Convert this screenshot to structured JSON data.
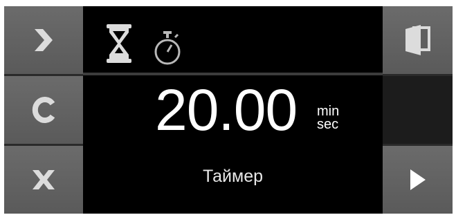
{
  "display": {
    "time_value": "20.00",
    "unit_top": "min",
    "unit_bottom": "sec",
    "mode_label": "Таймер"
  },
  "icons": {
    "left": [
      "chevron-right-icon",
      "clear-c-icon",
      "cancel-x-icon"
    ],
    "mode": [
      "hourglass-icon",
      "stopwatch-icon"
    ],
    "right": [
      "door-icon",
      "play-arrow-icon"
    ]
  },
  "colors": {
    "background": "#000000",
    "button": "#636363",
    "icon": "#dcdcdc",
    "text": "#ffffff"
  }
}
